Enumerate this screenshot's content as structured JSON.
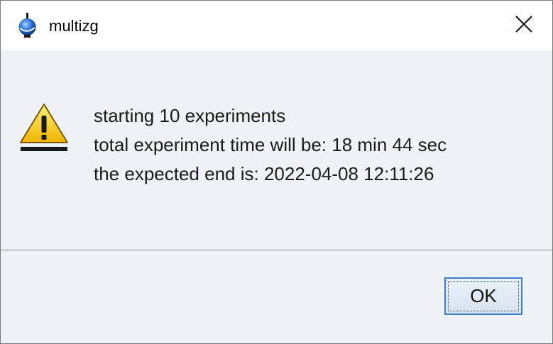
{
  "window": {
    "title": "multizg",
    "icon": "topspin-icon"
  },
  "title_bar": {
    "close_icon": "close-icon"
  },
  "message": {
    "icon": "warning-icon",
    "lines": [
      "starting 10 experiments",
      "total experiment time will be: 18 min 44 sec",
      "the expected end is: 2022-04-08 12:11:26"
    ]
  },
  "buttons": {
    "ok_label": "OK"
  },
  "colors": {
    "background": "#eef2f6",
    "titlebar": "#ffffff",
    "button_border": "#3c7fc8",
    "warning_yellow": "#f5c400"
  }
}
